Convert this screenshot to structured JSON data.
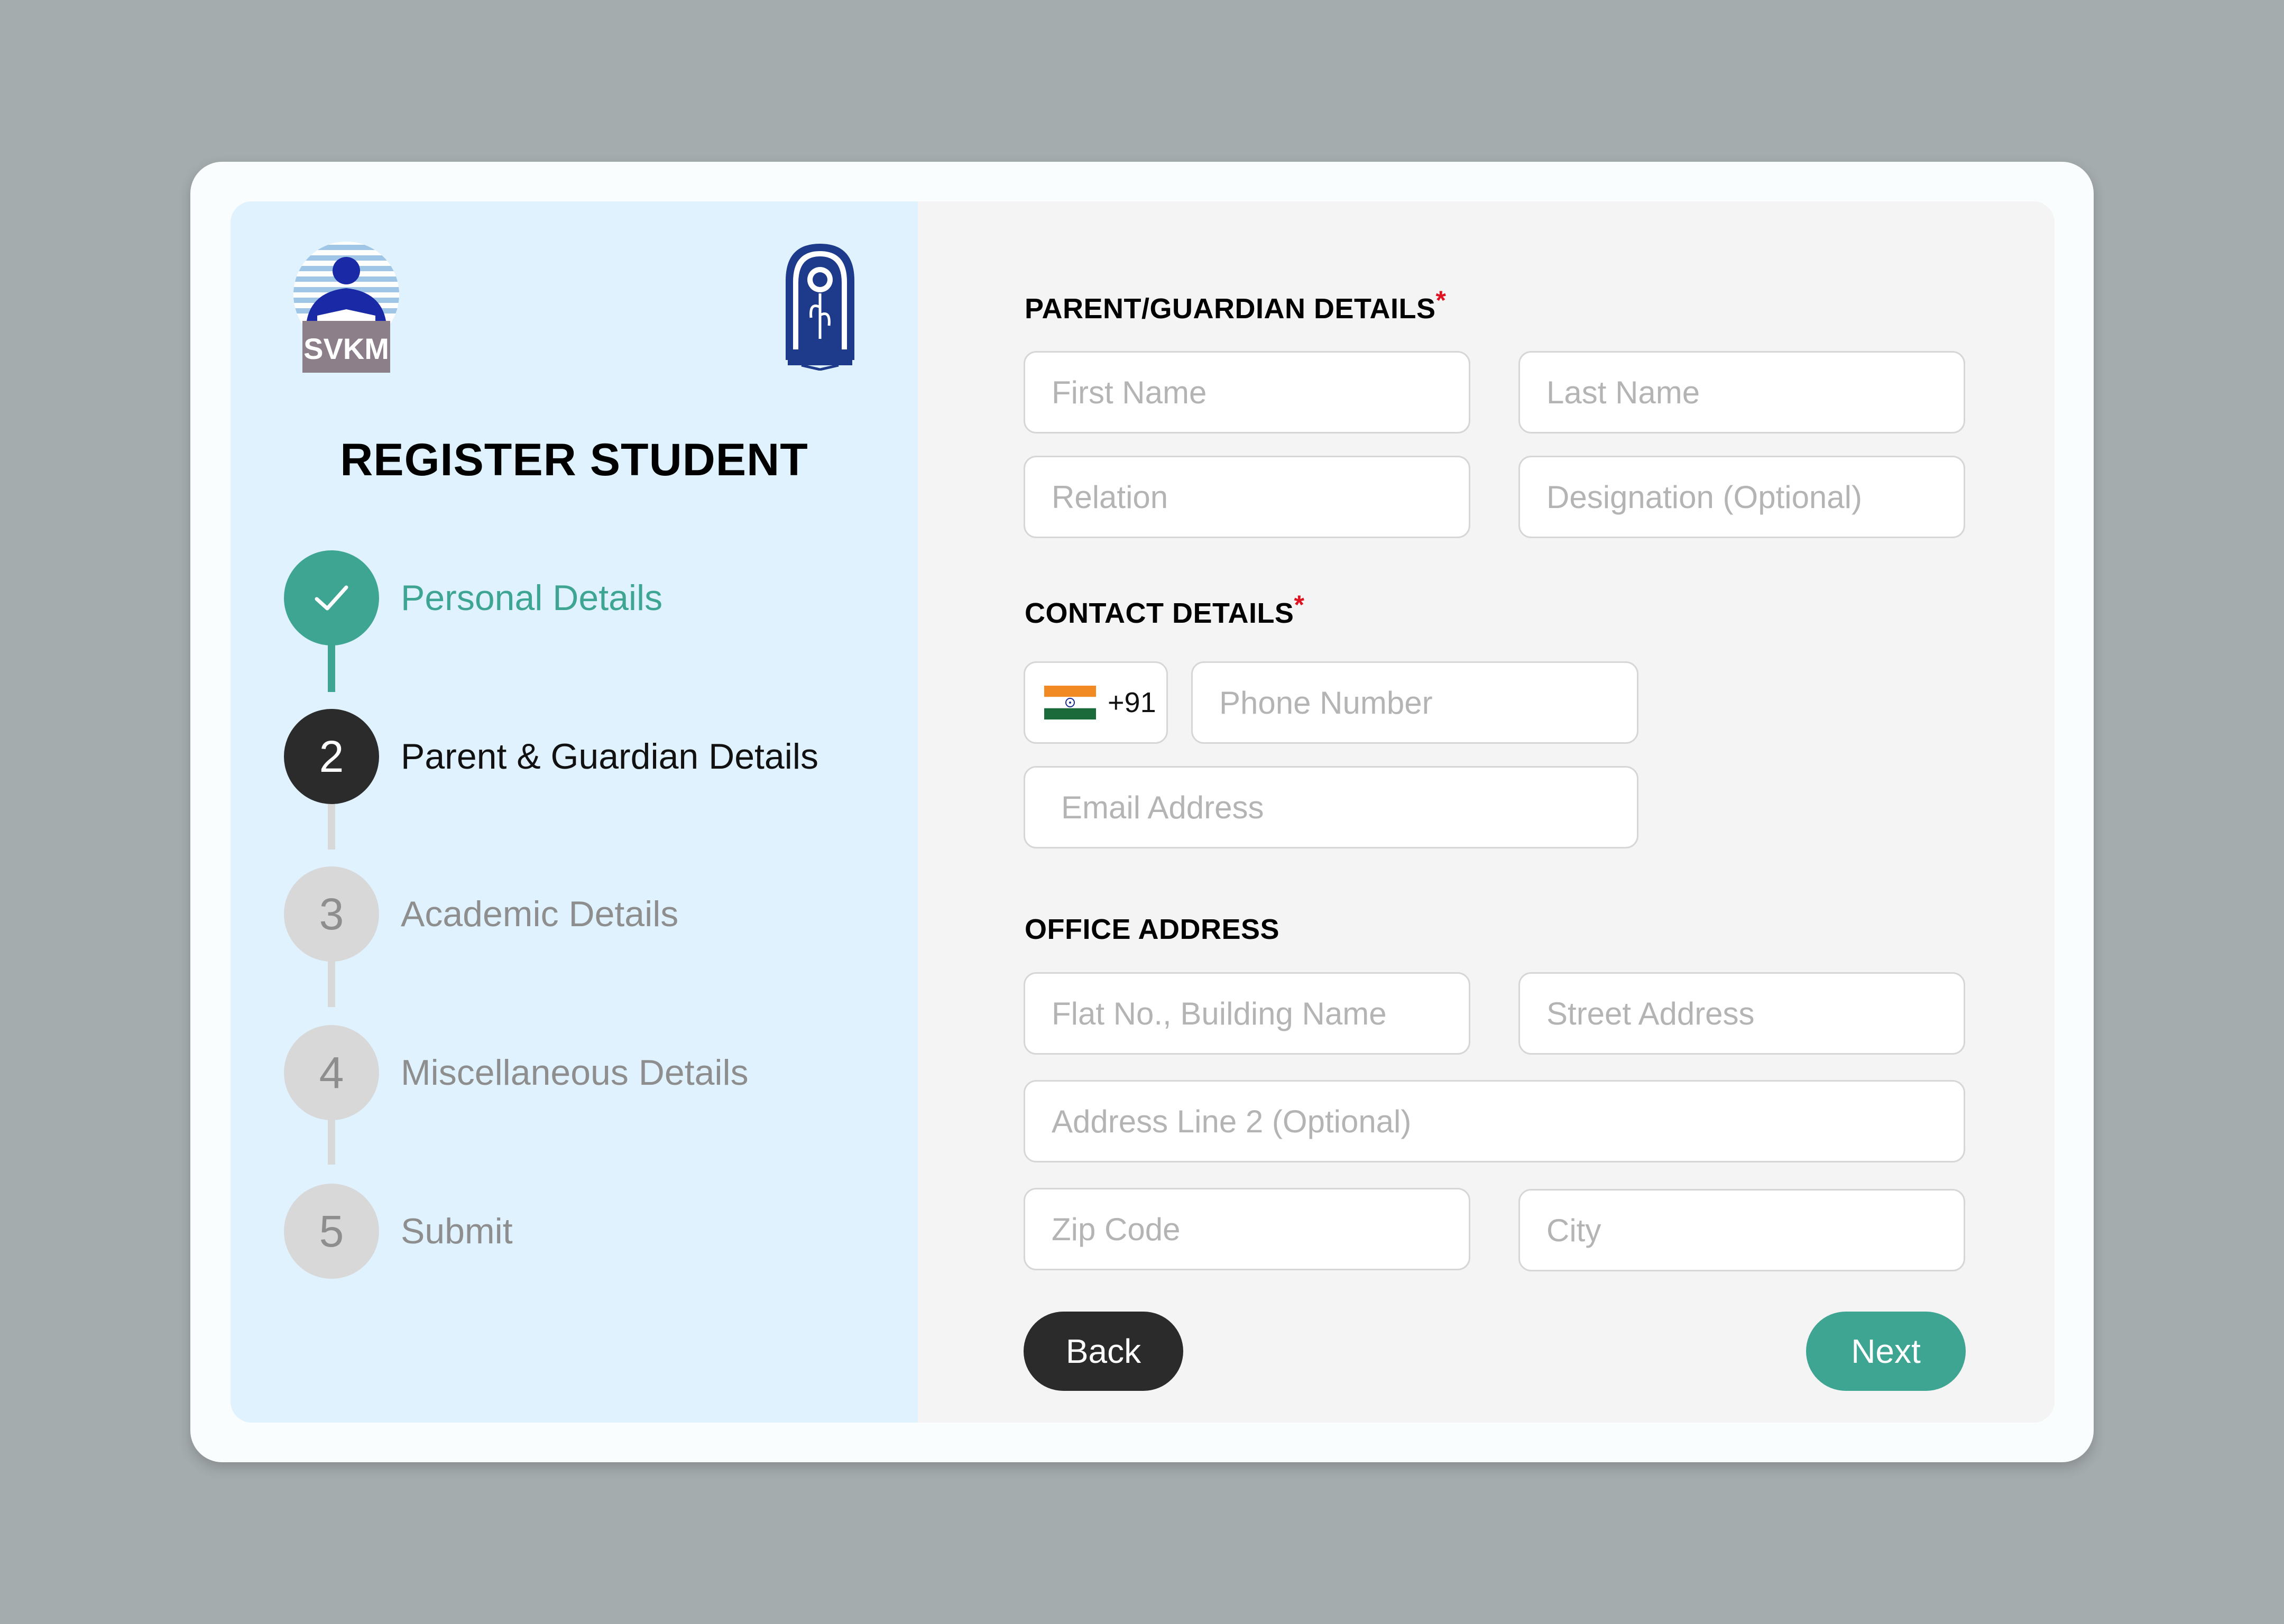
{
  "sidebar": {
    "title": "REGISTER STUDENT",
    "logo_left_text": "SVKM",
    "steps": [
      {
        "marker": "",
        "label": "Personal Details",
        "status": "completed"
      },
      {
        "marker": "2",
        "label": "Parent & Guardian Details",
        "status": "active"
      },
      {
        "marker": "3",
        "label": "Academic Details",
        "status": "pending"
      },
      {
        "marker": "4",
        "label": "Miscellaneous Details",
        "status": "pending"
      },
      {
        "marker": "5",
        "label": "Submit",
        "status": "pending"
      }
    ]
  },
  "sections": {
    "parent": {
      "title": "PARENT/GUARDIAN DETAILS",
      "required_mark": "*",
      "first_name_placeholder": "First Name",
      "last_name_placeholder": "Last Name",
      "relation_placeholder": "Relation",
      "designation_placeholder": "Designation (Optional)"
    },
    "contact": {
      "title": "CONTACT DETAILS",
      "required_mark": "*",
      "country_code": "+91",
      "country_flag_icon": "india-flag-icon",
      "phone_placeholder": "Phone Number",
      "email_placeholder": "Email Address"
    },
    "office": {
      "title": "OFFICE ADDRESS",
      "flat_placeholder": "Flat No., Building Name",
      "street_placeholder": "Street Address",
      "address2_placeholder": "Address Line 2 (Optional)",
      "zip_placeholder": "Zip Code",
      "city_placeholder": "City"
    }
  },
  "buttons": {
    "back": "Back",
    "next": "Next"
  },
  "colors": {
    "accent_green": "#3fa593",
    "active_dark": "#2b2b2b",
    "pending_grey": "#d8d8d8",
    "sidebar_bg": "#dff2fd",
    "required_red": "#e0121f"
  }
}
